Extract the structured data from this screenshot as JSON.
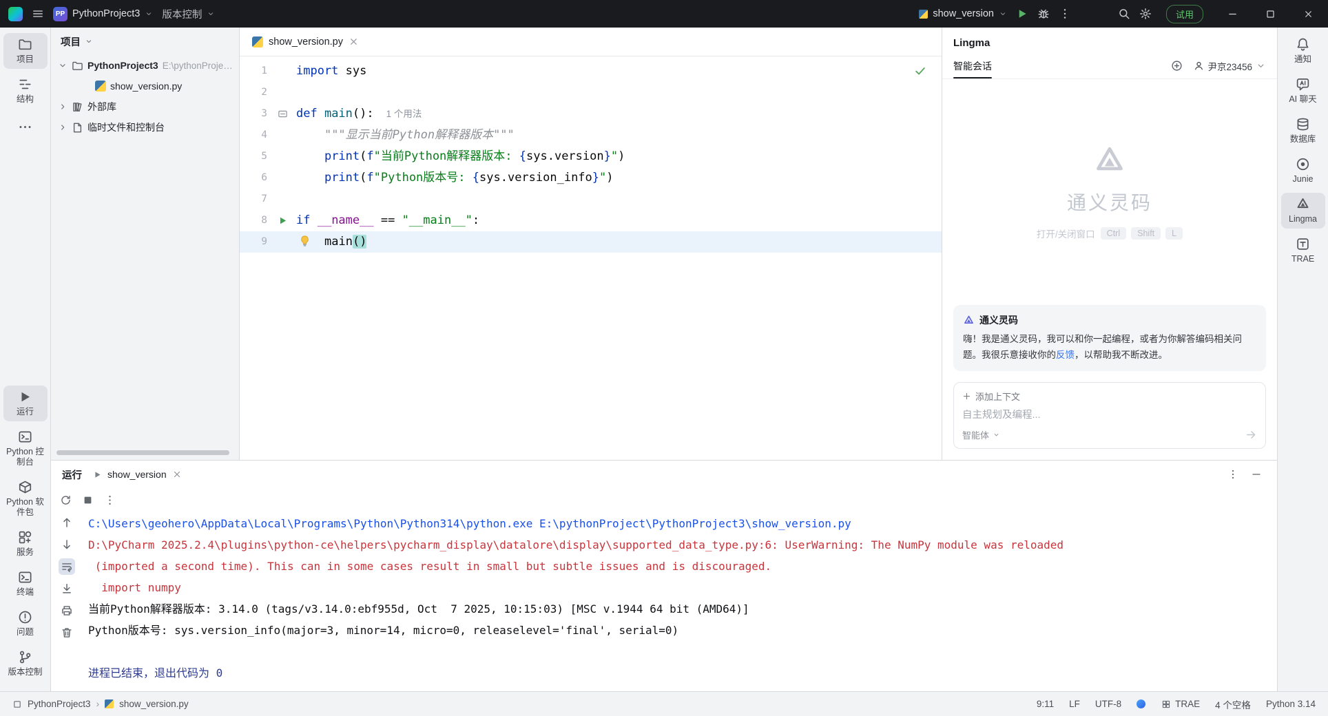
{
  "colors": {
    "accent": "#3574f0",
    "run_green": "#43a047",
    "error_red": "#c7353c",
    "link_blue": "#1750eb",
    "match_teal": "#a7e0da"
  },
  "titlebar": {
    "project_initials": "PP",
    "project_name": "PythonProject3",
    "vcs": "版本控制",
    "run_config": "show_version",
    "trial": "试用"
  },
  "left_stripe": {
    "top": [
      {
        "id": "project",
        "icon": "folder",
        "label": "项目",
        "selected": true
      },
      {
        "id": "structure",
        "icon": "structure",
        "label": "结构",
        "selected": false
      },
      {
        "id": "more",
        "icon": "more",
        "label": "",
        "selected": false
      }
    ],
    "bottom": [
      {
        "id": "run",
        "icon": "play",
        "label": "运行",
        "selected": true
      },
      {
        "id": "python-console",
        "icon": "console",
        "label": "Python 控制台",
        "selected": false
      },
      {
        "id": "python-packages",
        "icon": "package",
        "label": "Python 软件包",
        "selected": false
      },
      {
        "id": "services",
        "icon": "services",
        "label": "服务",
        "selected": false
      },
      {
        "id": "terminal",
        "icon": "terminal",
        "label": "终端",
        "selected": false
      },
      {
        "id": "problems",
        "icon": "problems",
        "label": "问题",
        "selected": false
      },
      {
        "id": "version-control",
        "icon": "vcs",
        "label": "版本控制",
        "selected": false
      }
    ]
  },
  "right_stripe": [
    {
      "id": "notifications",
      "icon": "bell",
      "label": "通知",
      "selected": false
    },
    {
      "id": "ai-chat",
      "icon": "aichat",
      "label": "AI 聊天",
      "selected": false
    },
    {
      "id": "database",
      "icon": "database",
      "label": "数据库",
      "selected": false
    },
    {
      "id": "junie",
      "icon": "junie",
      "label": "Junie",
      "selected": false
    },
    {
      "id": "lingma",
      "icon": "lingma",
      "label": "Lingma",
      "selected": true
    },
    {
      "id": "trae",
      "icon": "trae",
      "label": "TRAE",
      "selected": false
    }
  ],
  "project_panel": {
    "title": "项目",
    "tree": [
      {
        "id": "root",
        "expand": "open",
        "icon": "folder",
        "label": "PythonProject3",
        "bold": true,
        "path": "E:\\pythonProject\\P",
        "indent": 0
      },
      {
        "id": "show-version-file",
        "expand": "none",
        "icon": "python",
        "label": "show_version.py",
        "bold": false,
        "indent": 1
      },
      {
        "id": "external-libraries",
        "expand": "closed",
        "icon": "library",
        "label": "外部库",
        "bold": false,
        "indent": 0
      },
      {
        "id": "scratches",
        "expand": "closed",
        "icon": "scratch",
        "label": "临时文件和控制台",
        "bold": false,
        "indent": 0
      }
    ]
  },
  "editor": {
    "tab": {
      "label": "show_version.py"
    },
    "lines": [
      {
        "n": 1,
        "segs": [
          {
            "t": "import",
            "c": "kw"
          },
          {
            "t": " sys",
            "c": "pl"
          }
        ]
      },
      {
        "n": 2,
        "segs": []
      },
      {
        "n": 3,
        "gutter": "usage",
        "segs": [
          {
            "t": "def ",
            "c": "kw"
          },
          {
            "t": "main",
            "c": "fn"
          },
          {
            "t": "():",
            "c": "pl"
          },
          {
            "t": "1 个用法",
            "c": "hint"
          }
        ]
      },
      {
        "n": 4,
        "segs": [
          {
            "t": "    ",
            "c": "pl"
          },
          {
            "t": "\"\"\"显示当前Python解释器版本\"\"\"",
            "c": "doc"
          }
        ]
      },
      {
        "n": 5,
        "segs": [
          {
            "t": "    ",
            "c": "pl"
          },
          {
            "t": "print",
            "c": "kw"
          },
          {
            "t": "(",
            "c": "pl"
          },
          {
            "t": "f",
            "c": "kw"
          },
          {
            "t": "\"当前Python解释器版本: ",
            "c": "str"
          },
          {
            "t": "{",
            "c": "brace"
          },
          {
            "t": "sys.version",
            "c": "pl"
          },
          {
            "t": "}",
            "c": "brace"
          },
          {
            "t": "\"",
            "c": "str"
          },
          {
            "t": ")",
            "c": "pl"
          }
        ]
      },
      {
        "n": 6,
        "segs": [
          {
            "t": "    ",
            "c": "pl"
          },
          {
            "t": "print",
            "c": "kw"
          },
          {
            "t": "(",
            "c": "pl"
          },
          {
            "t": "f",
            "c": "kw"
          },
          {
            "t": "\"Python版本号: ",
            "c": "str"
          },
          {
            "t": "{",
            "c": "brace"
          },
          {
            "t": "sys.version_info",
            "c": "pl"
          },
          {
            "t": "}",
            "c": "brace"
          },
          {
            "t": "\"",
            "c": "str"
          },
          {
            "t": ")",
            "c": "pl"
          }
        ]
      },
      {
        "n": 7,
        "segs": []
      },
      {
        "n": 8,
        "gutter": "run",
        "segs": [
          {
            "t": "if ",
            "c": "kw"
          },
          {
            "t": "__name__",
            "c": "magic"
          },
          {
            "t": " == ",
            "c": "pl"
          },
          {
            "t": "\"__main__\"",
            "c": "str"
          },
          {
            "t": ":",
            "c": "pl"
          }
        ]
      },
      {
        "n": 9,
        "caret": true,
        "bulb": true,
        "segs": [
          {
            "t": "main",
            "c": "pl"
          },
          {
            "t": "()",
            "c": "match"
          }
        ]
      }
    ]
  },
  "lingma": {
    "title": "Lingma",
    "tab": "智能会话",
    "user": "尹京23456",
    "brand": "通义灵码",
    "shortcut_label": "打开/关闭窗口",
    "shortcut_keys": [
      "Ctrl",
      "Shift",
      "L"
    ],
    "card": {
      "title": "通义灵码",
      "body_pre": "嗨！我是通义灵码，我可以和你一起编程，或者为你解答编码相关问题。我很乐意接收你的",
      "body_link": "反馈",
      "body_post": "，以帮助我不断改进。"
    },
    "add_context": "添加上下文",
    "input_placeholder": "自主规划及编程...",
    "agent_label": "智能体"
  },
  "run_panel": {
    "title": "运行",
    "tab": "show_version",
    "console": [
      {
        "cls": "c-blue",
        "t": "C:\\Users\\geohero\\AppData\\Local\\Programs\\Python\\Python314\\python.exe E:\\pythonProject\\PythonProject3\\show_version.py"
      },
      {
        "cls": "c-red",
        "t": "D:\\PyCharm 2025.2.4\\plugins\\python-ce\\helpers\\pycharm_display\\datalore\\display\\supported_data_type.py:6: UserWarning: The NumPy module was reloaded"
      },
      {
        "cls": "c-red",
        "t": " (imported a second time). This can in some cases result in small but subtle issues and is discouraged."
      },
      {
        "cls": "c-red",
        "t": "  import numpy"
      },
      {
        "cls": "c-black",
        "t": "当前Python解释器版本: 3.14.0 (tags/v3.14.0:ebf955d, Oct  7 2025, 10:15:03) [MSC v.1944 64 bit (AMD64)]"
      },
      {
        "cls": "c-black",
        "t": "Python版本号: sys.version_info(major=3, minor=14, micro=0, releaselevel='final', serial=0)"
      },
      {
        "cls": "c-black",
        "t": ""
      },
      {
        "cls": "c-exit",
        "t": "进程已结束，退出代码为 0"
      }
    ]
  },
  "statusbar": {
    "project": "PythonProject3",
    "file": "show_version.py",
    "right": [
      {
        "id": "caret-position",
        "label": "9:11"
      },
      {
        "id": "line-separator",
        "label": "LF"
      },
      {
        "id": "encoding",
        "label": "UTF-8"
      },
      {
        "id": "lingma",
        "icon": "lingma-dot"
      },
      {
        "id": "trae",
        "icon": "grid",
        "label": "TRAE"
      },
      {
        "id": "indent",
        "label": "4 个空格"
      },
      {
        "id": "interpreter",
        "label": "Python 3.14"
      }
    ]
  }
}
